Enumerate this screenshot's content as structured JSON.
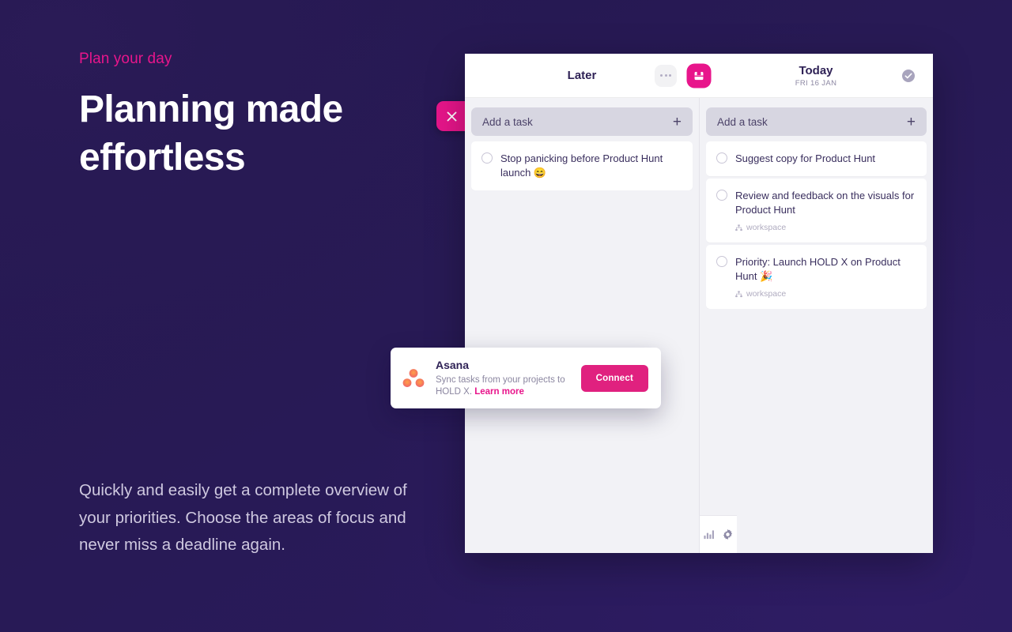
{
  "theme": {
    "background": "#271a52",
    "accent_pink": "#e8158b",
    "panel_bg": "#f2f2f6",
    "card_bg": "#ffffff",
    "text_dark": "#3a2f5e",
    "text_muted": "#b0acc0"
  },
  "marketing": {
    "eyebrow": "Plan your day",
    "headline": "Planning made effortless",
    "body": "Quickly and easily get a complete overview of your priorities. Choose the areas of focus and never miss a deadline again."
  },
  "close_button": {
    "icon": "close-icon",
    "label": "Close"
  },
  "app": {
    "header": {
      "left_title": "Later",
      "more_icon": "ellipsis-icon",
      "inbox_icon": "inbox-icon",
      "right_title": "Today",
      "right_subtitle": "FRI 16 JAN",
      "complete_icon": "check-circle-icon"
    },
    "columns": [
      {
        "id": "later",
        "title": "Later",
        "add_task_label": "Add a task",
        "add_task_placeholder": "Add a task",
        "add_icon": "plus-icon",
        "tasks": [
          {
            "text": "Stop panicking before Product Hunt launch 😄",
            "done": false,
            "workspace": null
          }
        ]
      },
      {
        "id": "today",
        "title": "Today",
        "add_task_label": "Add a task",
        "add_task_placeholder": "Add a task",
        "add_icon": "plus-icon",
        "tasks": [
          {
            "text": "Suggest copy for Product Hunt",
            "done": false,
            "workspace": null
          },
          {
            "text": "Review and feedback on the visuals for Product Hunt",
            "done": false,
            "workspace": "workspace"
          },
          {
            "text": "Priority: Launch HOLD X on Product Hunt 🎉",
            "done": false,
            "workspace": "workspace"
          }
        ]
      }
    ],
    "footer": {
      "stats_icon": "bar-chart-icon",
      "settings_icon": "gear-icon"
    }
  },
  "toast": {
    "logo_icon": "asana-logo-icon",
    "title": "Asana",
    "description": "Sync tasks from your projects to HOLD X. ",
    "link_label": "Learn more",
    "button_label": "Connect"
  }
}
